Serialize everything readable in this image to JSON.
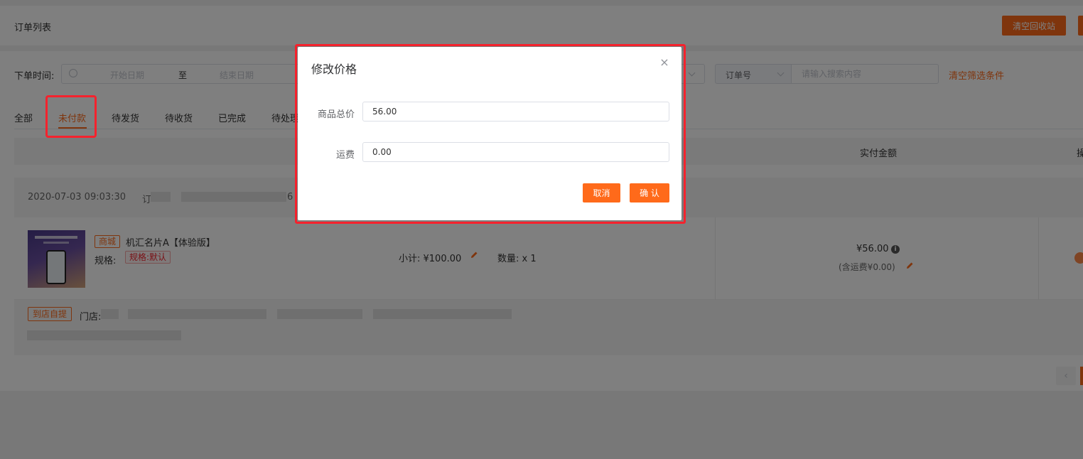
{
  "header": {
    "title": "订单列表",
    "clear_recycle_label": "清空回收站"
  },
  "filters": {
    "order_time_label": "下单时间:",
    "start_placeholder": "开始日期",
    "range_separator": "至",
    "end_placeholder": "结束日期",
    "search_type": "订单号",
    "search_placeholder": "请输入搜索内容",
    "clear_filters_label": "清空筛选条件"
  },
  "tabs": [
    {
      "label": "全部"
    },
    {
      "label": "未付款"
    },
    {
      "label": "待发货"
    },
    {
      "label": "待收货"
    },
    {
      "label": "已完成"
    },
    {
      "label": "待处理"
    }
  ],
  "table_header": {
    "paid_amount": "实付金额",
    "operation": "操"
  },
  "order": {
    "time": "2020-07-03 09:03:30",
    "order_no_prefix": "订",
    "order_no_tail": "6",
    "product": {
      "mall_tag": "商城",
      "name": "机汇名片A【体验版】",
      "spec_label": "规格:",
      "spec_value": "规格:默认",
      "subtotal": "小计: ¥100.00",
      "quantity": "数量: x 1"
    },
    "paid_amount": "¥56.00",
    "shipping_note": "(含运费¥0.00)",
    "pickup_tag": "到店自提",
    "store_label": "门店:"
  },
  "pager": {
    "prev": "‹"
  },
  "modal": {
    "title": "修改价格",
    "close": "×",
    "total_price_label": "商品总价",
    "total_price_value": "56.00",
    "shipping_label": "运费",
    "shipping_value": "0.00",
    "cancel_label": "取消",
    "confirm_label": "确 认"
  },
  "colors": {
    "accent": "#ff6a1a",
    "highlight": "#f5222d"
  }
}
